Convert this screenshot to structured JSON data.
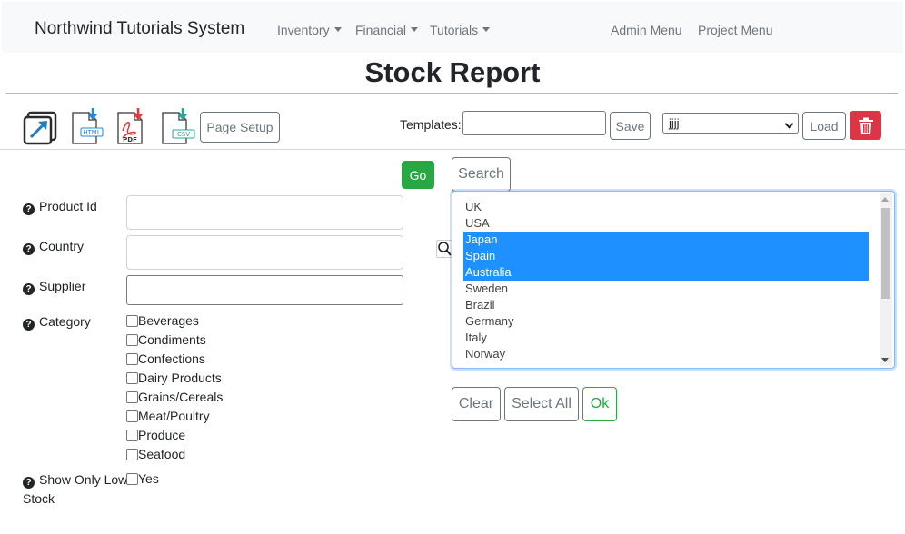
{
  "nav": {
    "brand": "Northwind Tutorials System",
    "inventory": "Inventory",
    "financial": "Financial",
    "tutorials": "Tutorials",
    "admin_menu": "Admin Menu",
    "project_menu": "Project Menu"
  },
  "page": {
    "title": "Stock Report"
  },
  "toolbar": {
    "page_setup": "Page Setup",
    "templates_label": "Templates:",
    "template_name_value": "",
    "save": "Save",
    "selected_template": "jjjj",
    "load": "Load",
    "icons": [
      "export-icon",
      "html-download-icon",
      "pdf-download-icon",
      "csv-download-icon",
      "trash-icon"
    ],
    "icon_text": {
      "html": "HTML",
      "pdf": "PDF",
      "csv": "CSV"
    }
  },
  "actions": {
    "go": "Go",
    "search": "Search",
    "clear": "Clear",
    "select_all": "Select All",
    "ok": "Ok"
  },
  "filters": {
    "product_id": {
      "label": "Product Id",
      "value": ""
    },
    "country": {
      "label": "Country",
      "value": ""
    },
    "supplier": {
      "label": "Supplier",
      "value": ""
    },
    "category": {
      "label": "Category",
      "options": [
        "Beverages",
        "Condiments",
        "Confections",
        "Dairy Products",
        "Grains/Cereals",
        "Meat/Poultry",
        "Produce",
        "Seafood"
      ]
    },
    "low_stock": {
      "label_line1": "Show Only Low",
      "label_line2": "Stock",
      "option": "Yes"
    }
  },
  "country_list": {
    "options": [
      "UK",
      "USA",
      "Japan",
      "Spain",
      "Australia",
      "Sweden",
      "Brazil",
      "Germany",
      "Italy",
      "Norway"
    ],
    "selected": [
      "Japan",
      "Spain",
      "Australia"
    ]
  },
  "colors": {
    "green": "#28a745",
    "red": "#dc3545",
    "selection": "#1e90ff",
    "navbar": "#f8f9fa"
  }
}
